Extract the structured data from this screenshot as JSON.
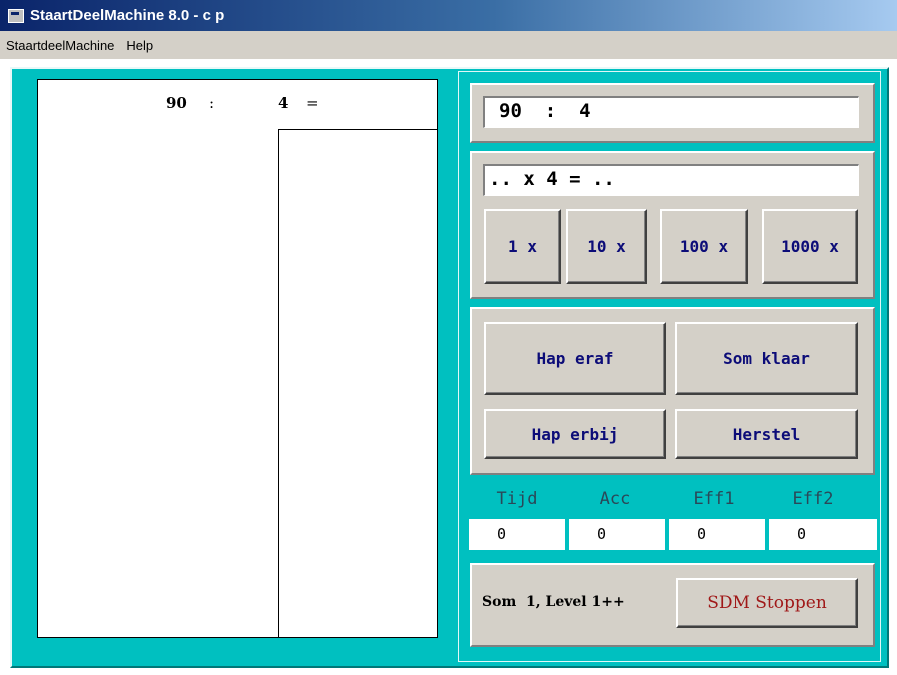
{
  "window": {
    "title": "StaartDeelMachine 8.0 - c p"
  },
  "menu": {
    "items": [
      "StaartdeelMachine",
      "Help"
    ]
  },
  "work": {
    "dividend": "90",
    "colon": ":",
    "divisor": "4",
    "equals": "="
  },
  "panel": {
    "sum_display": "90  :  4",
    "multiply_display": ".. x 4 = ..",
    "multiplier_buttons": [
      "1 x",
      "10 x",
      "100 x",
      "1000 x"
    ],
    "action_buttons": {
      "hap_eraf": "Hap eraf",
      "som_klaar": "Som klaar",
      "hap_erbij": "Hap erbij",
      "herstel": "Herstel"
    },
    "stats": {
      "labels": [
        "Tijd",
        "Acc",
        "Eff1",
        "Eff2"
      ],
      "values": [
        "0",
        "0",
        "0",
        "0"
      ]
    },
    "status": "Som  1, Level 1++",
    "stop_button": "SDM Stoppen"
  },
  "colors": {
    "frame": "#00c0c0",
    "title_bar": "#0a246a",
    "button_text": "#0c0c78",
    "stop_text": "#a01818"
  }
}
